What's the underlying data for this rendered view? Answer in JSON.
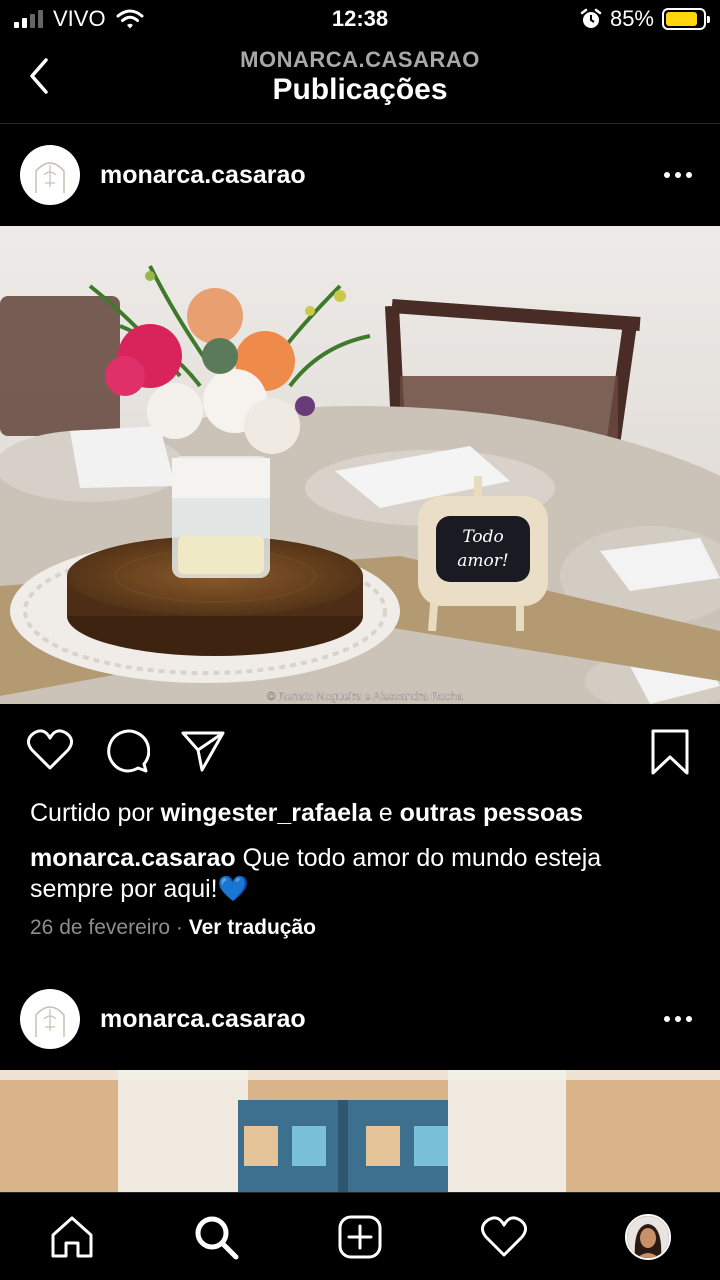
{
  "status_bar": {
    "carrier": "VIVO",
    "time": "12:38",
    "battery": "85%",
    "battery_level": 0.85,
    "battery_color": "#ffd60a"
  },
  "header": {
    "account": "MONARCA.CASARAO",
    "title": "Publicações"
  },
  "posts": [
    {
      "username": "monarca.casarao",
      "photo_credit": "© Renato Nogueira e Alessandra Rocha",
      "sign_text": [
        "Todo",
        "amor!"
      ],
      "liked_by_prefix": "Curtido por ",
      "liked_by_user": "wingester_rafaela",
      "liked_by_joiner": " e ",
      "liked_by_others": "outras pessoas",
      "caption_user": "monarca.casarao",
      "caption_text": " Que todo amor do mundo esteja sempre por aqui!💙",
      "date": "26 de fevereiro",
      "separator": " · ",
      "translate": "Ver tradução"
    },
    {
      "username": "monarca.casarao"
    }
  ],
  "tabs": [
    "home-icon",
    "search-icon",
    "new-post-icon",
    "activity-heart-icon",
    "profile-avatar"
  ]
}
